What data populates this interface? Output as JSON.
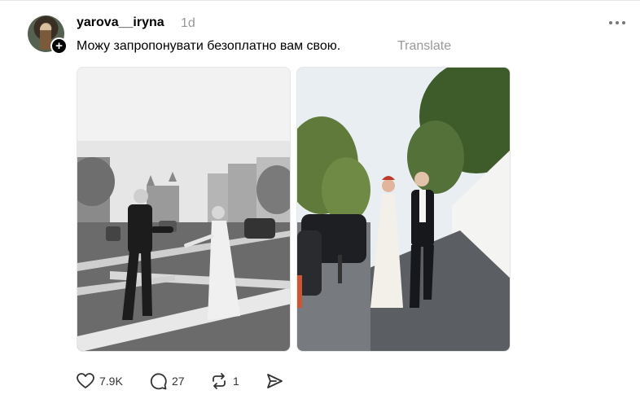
{
  "post": {
    "username": "yarova__iryna",
    "time": "1d",
    "text": "Можу запропонувати безоплатно вам свою.",
    "translate_label": "Translate",
    "follow_symbol": "+"
  },
  "images": [
    {
      "style": "black-and-white"
    },
    {
      "style": "color"
    }
  ],
  "actions": {
    "likes": "7.9K",
    "comments": "27",
    "reposts": "1"
  },
  "icons": [
    "more-icon",
    "heart-icon",
    "comment-icon",
    "repost-icon",
    "share-icon"
  ],
  "colors": {
    "text": "#000000",
    "muted": "#999999",
    "icon": "#333333"
  }
}
